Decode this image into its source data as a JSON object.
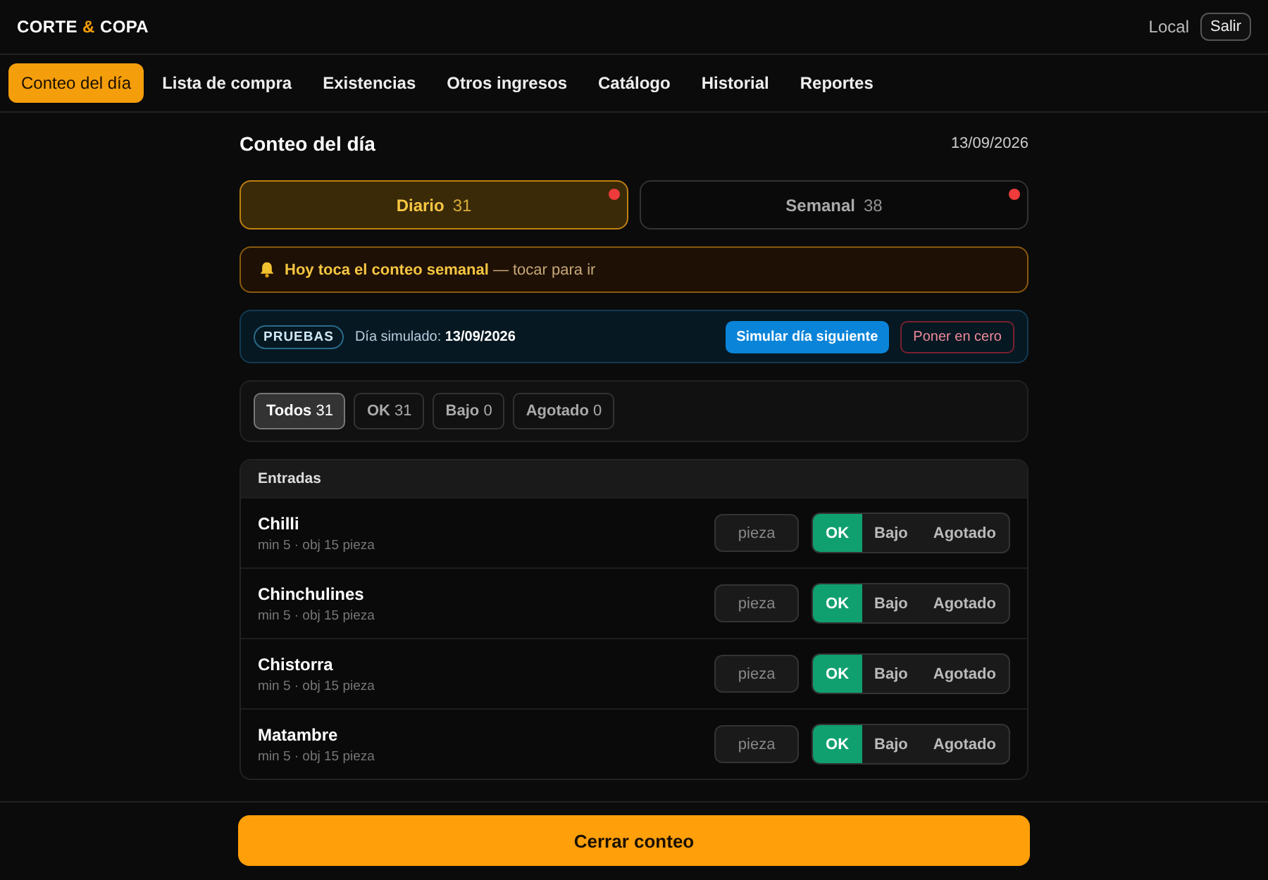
{
  "header": {
    "logo": {
      "word_1": "CORTE",
      "ampersand": "&",
      "word_2": "COPA"
    },
    "location": "Local",
    "logout": "Salir"
  },
  "nav": [
    {
      "label": "Conteo del día",
      "selected": true
    },
    {
      "label": "Lista de compra",
      "selected": false
    },
    {
      "label": "Existencias",
      "selected": false
    },
    {
      "label": "Otros ingresos",
      "selected": false
    },
    {
      "label": "Catálogo",
      "selected": false
    },
    {
      "label": "Historial",
      "selected": false
    },
    {
      "label": "Reportes",
      "selected": false
    }
  ],
  "page": {
    "title": "Conteo del día",
    "date": "13/09/2026"
  },
  "count_tabs": [
    {
      "label": "Diario",
      "count": "31",
      "selected": true,
      "pending": true
    },
    {
      "label": "Semanal",
      "count": "38",
      "selected": false,
      "pending": true
    }
  ],
  "alert": {
    "text": "**Hoy toca el conteo semanal** — tocar para ir"
  },
  "test_bar": {
    "badge": "PRUEBAS",
    "text": "Día simulado: **13/09/2026**",
    "next_button": "Simular día siguiente",
    "reset_button": "Poner en cero"
  },
  "filters": [
    {
      "label": "Todos",
      "count": "31",
      "selected": true
    },
    {
      "label": "OK",
      "count": "31",
      "selected": false
    },
    {
      "label": "Bajo",
      "count": "0",
      "selected": false
    },
    {
      "label": "Agotado",
      "count": "0",
      "selected": false
    }
  ],
  "section": {
    "title": "Entradas",
    "items": [
      {
        "name": "Chilli",
        "detail": "min 5 · obj 15 pieza",
        "placeholder": "pieza",
        "statuses": [
          {
            "label": "OK",
            "selected": true
          },
          {
            "label": "Bajo",
            "selected": false
          },
          {
            "label": "Agotado",
            "selected": false
          }
        ]
      },
      {
        "name": "Chinchulines",
        "detail": "min 5 · obj 15 pieza",
        "placeholder": "pieza",
        "statuses": [
          {
            "label": "OK",
            "selected": true
          },
          {
            "label": "Bajo",
            "selected": false
          },
          {
            "label": "Agotado",
            "selected": false
          }
        ]
      },
      {
        "name": "Chistorra",
        "detail": "min 5 · obj 15 pieza",
        "placeholder": "pieza",
        "statuses": [
          {
            "label": "OK",
            "selected": true
          },
          {
            "label": "Bajo",
            "selected": false
          },
          {
            "label": "Agotado",
            "selected": false
          }
        ]
      },
      {
        "name": "Matambre",
        "detail": "min 5 · obj 15 pieza",
        "placeholder": "pieza",
        "statuses": [
          {
            "label": "OK",
            "selected": true
          },
          {
            "label": "Bajo",
            "selected": false
          },
          {
            "label": "Agotado",
            "selected": false
          }
        ]
      }
    ]
  },
  "footer": {
    "button": "Cerrar conteo"
  }
}
